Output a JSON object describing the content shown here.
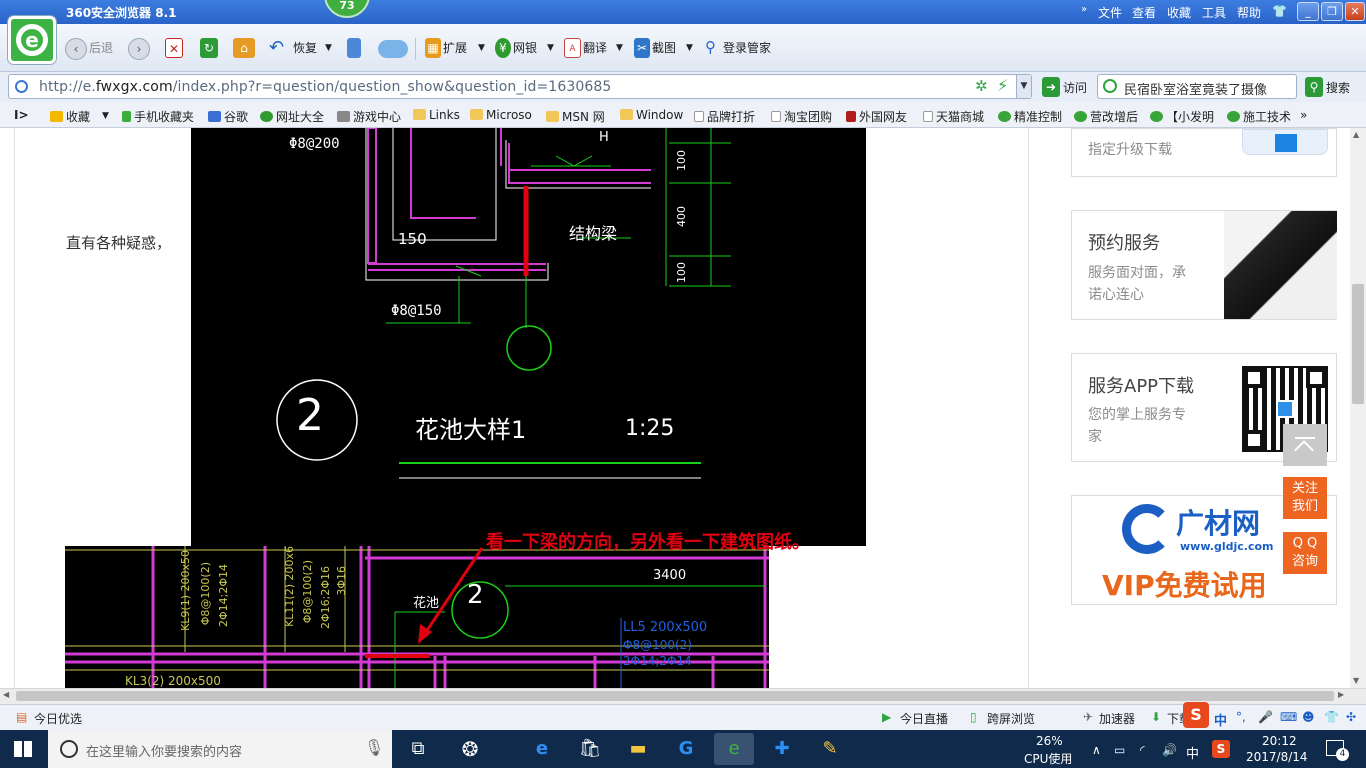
{
  "window": {
    "title": "360安全浏览器 8.1",
    "badge": "73",
    "menu": [
      "文件",
      "查看",
      "收藏",
      "工具",
      "帮助"
    ],
    "controls": [
      "_",
      "❐",
      "✕"
    ]
  },
  "toolbar": {
    "back_label": "后退",
    "restore_label": "恢复",
    "extensions_label": "扩展",
    "netbank_label": "网银",
    "translate_label": "翻译",
    "screenshot_label": "截图",
    "login_label": "登录管家"
  },
  "address": {
    "url_prefix": "http://e.",
    "url_domain": "fwxgx.com",
    "url_rest": "/index.php?r=question/question_show&question_id=1630685",
    "go_label": "访问",
    "search_value": "民宿卧室浴室竟装了摄像",
    "search_button": "搜索"
  },
  "bookmarks": [
    {
      "label": "收藏",
      "color": "#f5b800"
    },
    {
      "label": "手机收藏夹",
      "color": "#3cae3c"
    },
    {
      "label": "谷歌",
      "color": "#3b6fd6"
    },
    {
      "label": "网址大全",
      "color": "#2f9a2f"
    },
    {
      "label": "游戏中心",
      "color": "#888888"
    },
    {
      "label": "Links",
      "color": "#f1c75a"
    },
    {
      "label": "Microso",
      "color": "#f1c75a"
    },
    {
      "label": "MSN 网",
      "color": "#f1c75a"
    },
    {
      "label": "Window",
      "color": "#f1c75a"
    },
    {
      "label": "品牌打折",
      "color": "#dddddd"
    },
    {
      "label": "淘宝团购",
      "color": "#dddddd"
    },
    {
      "label": "外国网友",
      "color": "#b01c1c"
    },
    {
      "label": "天猫商城",
      "color": "#dddddd"
    },
    {
      "label": "精准控制",
      "color": "#37a437"
    },
    {
      "label": "营改增后",
      "color": "#37a437"
    },
    {
      "label": "【小发明",
      "color": "#37a437"
    },
    {
      "label": "施工技术",
      "color": "#37a437"
    }
  ],
  "content": {
    "text_fragment": "直有各种疑惑，",
    "annotation": "看一下梁的方向，另外看一下建筑图纸。",
    "cad_top": {
      "labels": {
        "rebar_top": "Φ8@200",
        "dim_150": "150",
        "structural_beam": "结构梁",
        "rebar_bottom": "Φ8@150",
        "title": "花池大样1",
        "scale": "1:25",
        "circle_number": "2",
        "dim_100a": "100",
        "dim_400": "400",
        "dim_100b": "100",
        "h_mark": "H"
      }
    },
    "cad_bottom": {
      "labels": {
        "kl9": "KL9(1) 200x50",
        "kl9_b": "Φ8@100(2)",
        "kl9_c": "2Φ14;2Φ14",
        "kl11": "KL11(2) 200x6",
        "kl11_b": "Φ8@100(2)",
        "kl11_c": "2Φ16;2Φ16",
        "kl11_d": "3Φ16",
        "flower": "花池",
        "circle_number": "2",
        "dim_3400": "3400",
        "ll5": "LL5 200x500",
        "ll5_b": "Φ8@100(2)",
        "ll5_c": "2Φ14;2Φ14",
        "kl3": "KL3(2) 200x500"
      }
    }
  },
  "sidebar": {
    "upgrade_text": "指定升级下载",
    "appointment": {
      "title": "预约服务",
      "desc1": "服务面对面，承",
      "desc2": "诺心连心"
    },
    "app": {
      "title": "服务APP下载",
      "desc1": "您的掌上服务专",
      "desc2": "家"
    },
    "ad": {
      "brand": "广材网",
      "url": "www.gldjc.com",
      "slogan": "VIP免费试用"
    },
    "follow_button": [
      "关注",
      "我们"
    ],
    "qq_button": [
      "Q Q",
      "咨询"
    ]
  },
  "statusbar": {
    "left": "今日优选",
    "live": "今日直播",
    "cross_screen": "跨屏浏览",
    "accelerator": "加速器",
    "download": "下载"
  },
  "taskbar": {
    "search_placeholder": "在这里输入你要搜索的内容",
    "cpu_percent": "26%",
    "cpu_label": "CPU使用",
    "ime": "中",
    "time": "20:12",
    "date": "2017/8/14",
    "notification_count": "4"
  },
  "colors": {
    "accent_blue": "#2a63c8",
    "cad_green": "#18d018",
    "cad_magenta": "#d33ad3",
    "annotation_red": "#e0000f",
    "side_orange": "#ee6521"
  }
}
